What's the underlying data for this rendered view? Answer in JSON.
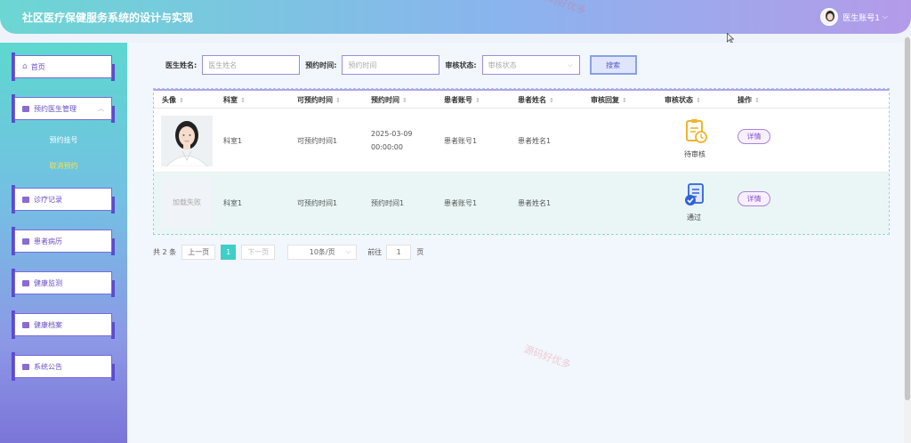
{
  "header": {
    "title": "社区医疗保健服务系统的设计与实现",
    "user_name": "医生账号1"
  },
  "sidebar": {
    "items": [
      {
        "label": "首页"
      },
      {
        "label": "预约医生管理"
      },
      {
        "label": "诊疗记录"
      },
      {
        "label": "患者病历"
      },
      {
        "label": "健康监测"
      },
      {
        "label": "健康档案"
      },
      {
        "label": "系统公告"
      }
    ],
    "sub_items": [
      {
        "label": "预约挂号",
        "color": "#ffffff"
      },
      {
        "label": "取消预约",
        "color": "#f7e24a"
      }
    ]
  },
  "search": {
    "doctor_label": "医生姓名:",
    "doctor_placeholder": "医生姓名",
    "time_label": "预约时间:",
    "time_placeholder": "预约时间",
    "status_label": "审核状态:",
    "status_placeholder": "审核状态",
    "button": "搜索"
  },
  "table": {
    "headers": [
      "头像",
      "科室",
      "可预约时间",
      "预约时间",
      "患者账号",
      "患者姓名",
      "审核回复",
      "审核状态",
      "操作"
    ],
    "rows": [
      {
        "avatar_text": "",
        "department": "科室1",
        "available_time": "可预约时间1",
        "appointment_time": "2025-03-09 00:00:00",
        "patient_account": "患者账号1",
        "patient_name": "患者姓名1",
        "reply": "",
        "status": "待审核",
        "action": "详情"
      },
      {
        "avatar_text": "加载失败",
        "department": "科室1",
        "available_time": "可预约时间1",
        "appointment_time": "预约时间1",
        "patient_account": "患者账号1",
        "patient_name": "患者姓名1",
        "reply": "",
        "status": "通过",
        "action": "详情"
      }
    ]
  },
  "pager": {
    "total": "共 2 条",
    "prev": "上一页",
    "current": "1",
    "next": "下一页",
    "page_size": "10条/页",
    "goto_label": "前往",
    "goto_value": "1",
    "page_suffix": "页"
  },
  "watermark": "源码好优多",
  "colors": {
    "accent": "#3fcfc8",
    "brand_purple": "#7b6ad8"
  }
}
